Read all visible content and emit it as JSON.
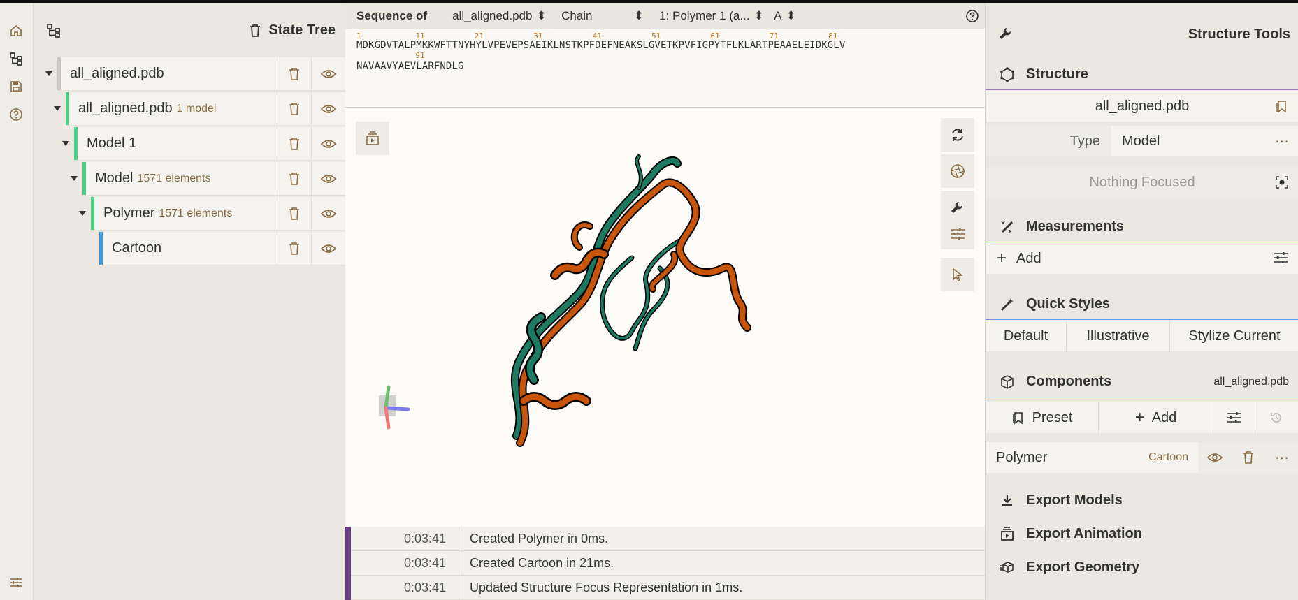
{
  "state_tree": {
    "title": "State Tree",
    "nodes": [
      {
        "label": "all_aligned.pdb",
        "sub": ""
      },
      {
        "label": "all_aligned.pdb",
        "sub": "1 model"
      },
      {
        "label": "Model 1",
        "sub": ""
      },
      {
        "label": "Model",
        "sub": "1571 elements"
      },
      {
        "label": "Polymer",
        "sub": "1571 elements"
      },
      {
        "label": "Cartoon",
        "sub": ""
      }
    ]
  },
  "sequence": {
    "label": "Sequence of",
    "structure": "all_aligned.pdb",
    "mode": "Chain",
    "entity": "1: Polymer 1 (a...",
    "chain": "A",
    "line1": "MDKGDVTALPMKKWFTTNYHYLVPEVEPSAEIKLNSTKPFDEFNEAKSLGVETKPVFIGPYTFLKLARTPEAAELEIDKGLV",
    "line2": "NAVAAVYAEVLARFNDLG",
    "numbers1": [
      "1",
      "11",
      "21",
      "31",
      "41",
      "51",
      "61",
      "71",
      "81"
    ],
    "numbers2": [
      "91"
    ]
  },
  "log": [
    {
      "time": "0:03:41",
      "message": "Created Polymer in 0ms."
    },
    {
      "time": "0:03:41",
      "message": "Created Cartoon in 21ms."
    },
    {
      "time": "0:03:41",
      "message": "Updated Structure Focus Representation in 1ms."
    }
  ],
  "tools": {
    "title": "Structure Tools",
    "structure_title": "Structure",
    "structure_name": "all_aligned.pdb",
    "type_label": "Type",
    "type_value": "Model",
    "focus": "Nothing Focused",
    "measurements_title": "Measurements",
    "add_label": "Add",
    "quick_styles_title": "Quick Styles",
    "styles": [
      "Default",
      "Illustrative",
      "Stylize Current"
    ],
    "components_title": "Components",
    "components_structure": "all_aligned.pdb",
    "preset_label": "Preset",
    "components_add": "Add",
    "component_name": "Polymer",
    "component_repr": "Cartoon",
    "export_models": "Export Models",
    "export_animation": "Export Animation",
    "export_geometry": "Export Geometry"
  },
  "colors": {
    "accent": "#6b3c86",
    "orange_chain": "#c8550c",
    "green_chain": "#1f7a62",
    "tree_bar_root": "#c9c9c9",
    "tree_bar_green": "#4fcf86",
    "tree_bar_blue": "#3b9be0"
  }
}
